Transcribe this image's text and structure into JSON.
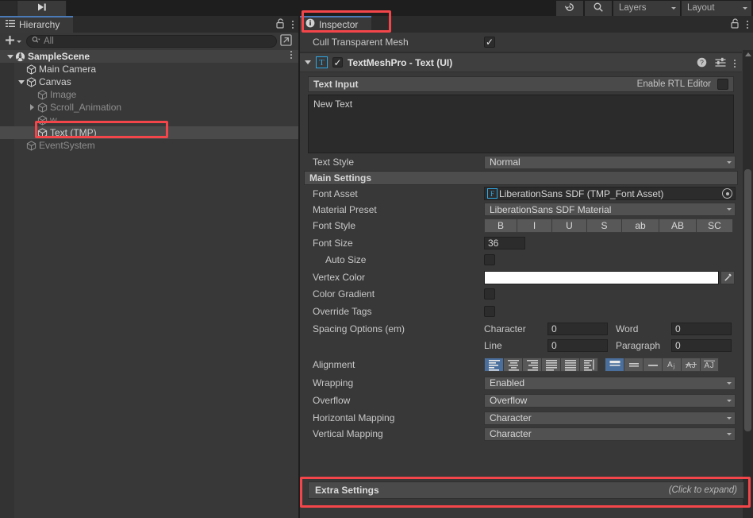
{
  "toolbar": {
    "step_icon": "step-forward-icon",
    "history_icon": "history-undo-icon",
    "search_icon": "search-icon",
    "layers_label": "Layers",
    "layout_label": "Layout"
  },
  "hierarchy": {
    "tab_label": "Hierarchy",
    "tab_icon": "hierarchy-icon",
    "lock_icon": "lock-open-icon",
    "menu_icon": "kebab-menu-icon",
    "add_label": "+",
    "search_placeholder": "All",
    "search_icon": "search-dropdown-icon",
    "pick_icon": "scene-picker-icon",
    "items": [
      {
        "label": "SampleScene",
        "depth": 0,
        "expanded": true,
        "type": "scene",
        "dim": false,
        "selected": false
      },
      {
        "label": "Main Camera",
        "depth": 1,
        "expanded": null,
        "type": "gameobject",
        "dim": false,
        "selected": false
      },
      {
        "label": "Canvas",
        "depth": 1,
        "expanded": true,
        "type": "gameobject",
        "dim": false,
        "selected": false
      },
      {
        "label": "Image",
        "depth": 2,
        "expanded": null,
        "type": "gameobject",
        "dim": true,
        "selected": false
      },
      {
        "label": "Scroll_Animation",
        "depth": 2,
        "expanded": false,
        "type": "gameobject",
        "dim": true,
        "selected": false
      },
      {
        "label": "w",
        "depth": 2,
        "expanded": null,
        "type": "gameobject",
        "dim": true,
        "selected": false
      },
      {
        "label": "Text (TMP)",
        "depth": 2,
        "expanded": null,
        "type": "gameobject",
        "dim": false,
        "selected": true
      },
      {
        "label": "EventSystem",
        "depth": 1,
        "expanded": null,
        "type": "gameobject",
        "dim": true,
        "selected": false
      }
    ]
  },
  "inspector": {
    "tab_label": "Inspector",
    "tab_icon": "info-icon",
    "lock_icon": "lock-open-icon",
    "menu_icon": "kebab-menu-icon",
    "cull_transparent_mesh": {
      "label": "Cull Transparent Mesh",
      "checked": true
    },
    "component": {
      "title": "TextMeshPro - Text (UI)",
      "icon": "tmp-text-icon",
      "enabled": true,
      "help_icon": "help-icon",
      "preset_icon": "preset-sliders-icon",
      "menu_icon": "kebab-menu-icon"
    },
    "text_input": {
      "section_label": "Text Input",
      "rtl_label": "Enable RTL Editor",
      "rtl_checked": false,
      "value": "New Text"
    },
    "text_style": {
      "label": "Text Style",
      "value": "Normal"
    },
    "main_settings_label": "Main Settings",
    "font_asset": {
      "label": "Font Asset",
      "value": "LiberationSans SDF (TMP_Font Asset)",
      "icon": "font-asset-icon",
      "picker_icon": "object-picker-icon"
    },
    "material_preset": {
      "label": "Material Preset",
      "value": "LiberationSans SDF Material"
    },
    "font_style": {
      "label": "Font Style",
      "buttons": [
        {
          "label": "B",
          "active": false
        },
        {
          "label": "I",
          "active": false
        },
        {
          "label": "U",
          "active": false
        },
        {
          "label": "S",
          "active": false
        },
        {
          "label": "ab",
          "active": false
        },
        {
          "label": "AB",
          "active": false
        },
        {
          "label": "SC",
          "active": false
        }
      ]
    },
    "font_size": {
      "label": "Font Size",
      "value": "36"
    },
    "auto_size": {
      "label": "Auto Size",
      "checked": false
    },
    "vertex_color": {
      "label": "Vertex Color",
      "color": "#ffffff",
      "eyedropper_icon": "eyedropper-icon"
    },
    "color_gradient": {
      "label": "Color Gradient",
      "checked": false
    },
    "override_tags": {
      "label": "Override Tags",
      "checked": false
    },
    "spacing_options": {
      "label": "Spacing Options (em)",
      "character": {
        "label": "Character",
        "value": "0"
      },
      "word": {
        "label": "Word",
        "value": "0"
      },
      "line": {
        "label": "Line",
        "value": "0"
      },
      "paragraph": {
        "label": "Paragraph",
        "value": "0"
      }
    },
    "alignment": {
      "label": "Alignment",
      "horizontal": [
        {
          "icon": "align-left-icon",
          "active": true
        },
        {
          "icon": "align-center-icon",
          "active": false
        },
        {
          "icon": "align-right-icon",
          "active": false
        },
        {
          "icon": "align-justified-icon",
          "active": false
        },
        {
          "icon": "align-flush-icon",
          "active": false
        },
        {
          "icon": "align-geometry-center-icon",
          "active": false
        }
      ],
      "vertical": [
        {
          "icon": "align-top-icon",
          "active": true
        },
        {
          "icon": "align-middle-icon",
          "active": false
        },
        {
          "icon": "align-bottom-icon",
          "active": false
        },
        {
          "icon": "align-baseline-icon",
          "active": false
        },
        {
          "icon": "align-midline-icon",
          "active": false
        },
        {
          "icon": "align-capline-icon",
          "active": false
        }
      ]
    },
    "wrapping": {
      "label": "Wrapping",
      "value": "Enabled"
    },
    "overflow": {
      "label": "Overflow",
      "value": "Overflow"
    },
    "horizontal_mapping": {
      "label": "Horizontal Mapping",
      "value": "Character"
    },
    "vertical_mapping": {
      "label": "Vertical Mapping",
      "value": "Character"
    },
    "extra_settings": {
      "label": "Extra Settings",
      "hint": "(Click to expand)"
    }
  },
  "colors": {
    "annotation": "#f4464a",
    "accent_blue": "#4a6f9c",
    "tmp_blue": "#2ea8e6",
    "panel_bg": "#383838",
    "tab_bg": "#2b2b2b"
  }
}
